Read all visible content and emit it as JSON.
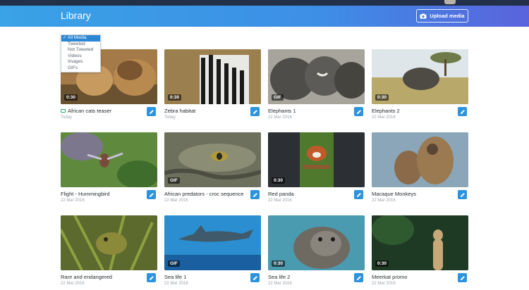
{
  "header": {
    "title": "Library",
    "upload_label": "Upload media"
  },
  "filter": {
    "options": [
      "All Media",
      "Tweeted",
      "Not Tweeted",
      "Videos",
      "Images",
      "GIFs"
    ],
    "selected_marker": "✓"
  },
  "media": [
    {
      "name": "African cats teaser",
      "date": "Today",
      "badge": "0:30",
      "type": "video",
      "tweeted": true
    },
    {
      "name": "Zebra habitat",
      "date": "Today",
      "badge": "0:30",
      "type": "video"
    },
    {
      "name": "Elephants 1",
      "date": "22 Mar 2016",
      "badge": "GIF",
      "type": "gif"
    },
    {
      "name": "Elephants 2",
      "date": "22 Mar 2016",
      "badge": "0:30",
      "type": "video"
    },
    {
      "name": "Flight - Hummingbird",
      "date": "22 Mar 2016",
      "badge": "",
      "type": "image"
    },
    {
      "name": "African predators - croc sequence",
      "date": "22 Mar 2016",
      "badge": "GIF",
      "type": "gif"
    },
    {
      "name": "Red panda",
      "date": "22 Mar 2016",
      "badge": "0:30",
      "type": "video"
    },
    {
      "name": "Macaque Monkeys",
      "date": "22 Mar 2016",
      "badge": "",
      "type": "image"
    },
    {
      "name": "Rare and endangered",
      "date": "22 Mar 2016",
      "badge": "",
      "type": "image"
    },
    {
      "name": "Sea life 1",
      "date": "22 Mar 2016",
      "badge": "GIF",
      "type": "gif"
    },
    {
      "name": "Sea life 2",
      "date": "22 Mar 2016",
      "badge": "0:30",
      "type": "video"
    },
    {
      "name": "Meerkat promo",
      "date": "22 Mar 2016",
      "badge": "0:30",
      "type": "video"
    }
  ],
  "colors": {
    "accent": "#2b93e0",
    "header_start": "#3aa2e6",
    "header_end": "#5a63dc"
  }
}
